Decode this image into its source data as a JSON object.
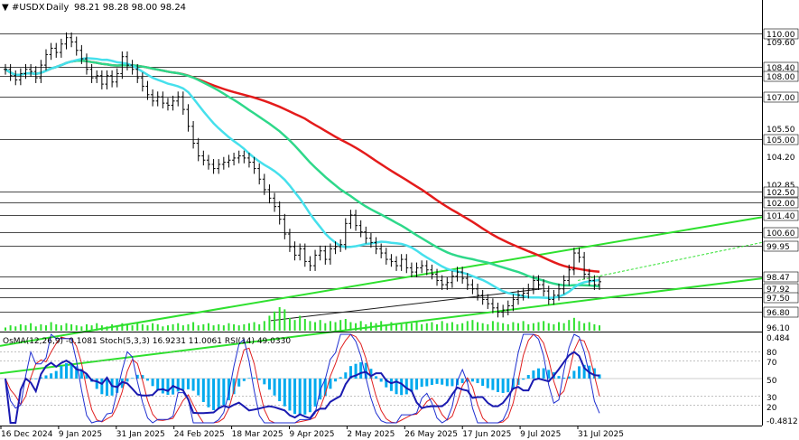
{
  "chart_data": [
    {
      "type": "candlestick",
      "symbol": "#USDX",
      "timeframe": "Daily",
      "ohlc_header": "98.21 98.28 98.00 98.24",
      "x_tick_labels": [
        "16 Dec 2024",
        "9 Jan 2025",
        "31 Jan 2025",
        "24 Feb 2025",
        "18 Mar 2025",
        "9 Apr 2025",
        "2 May 2025",
        "26 May 2025",
        "17 Jun 2025",
        "9 Jul 2025",
        "31 Jul 2025"
      ],
      "y_range": [
        96.35,
        110.9
      ],
      "level_tags": [
        {
          "label": "110.00",
          "value": 110.0,
          "color": "#ffffff"
        },
        {
          "label": "109.60",
          "value": 109.6,
          "color": "#000000"
        },
        {
          "label": "108.40",
          "value": 108.4,
          "color": "#ffffff"
        },
        {
          "label": "108.00",
          "value": 108.0,
          "color": "#ffffff"
        },
        {
          "label": "107.00",
          "value": 107.0,
          "color": "#ffffff"
        },
        {
          "label": "105.50",
          "value": 105.5,
          "color": "#000000"
        },
        {
          "label": "105.00",
          "value": 105.0,
          "color": "#ffffff"
        },
        {
          "label": "104.20",
          "value": 104.2,
          "color": "#000000"
        },
        {
          "label": "102.85",
          "value": 102.85,
          "color": "#000000"
        },
        {
          "label": "102.50",
          "value": 102.5,
          "color": "#ffffff"
        },
        {
          "label": "102.00",
          "value": 102.0,
          "color": "#ffffff"
        },
        {
          "label": "101.40",
          "value": 101.4,
          "color": "#ffffff"
        },
        {
          "label": "100.60",
          "value": 100.6,
          "color": "#ffffff"
        },
        {
          "label": "99.95",
          "value": 99.95,
          "color": "#ffffff"
        },
        {
          "label": "98.47",
          "value": 98.47,
          "color": "#ffffff"
        },
        {
          "label": "97.92",
          "value": 97.92,
          "color": "#ffffff"
        },
        {
          "label": "97.50",
          "value": 97.5,
          "color": "#ffffff"
        },
        {
          "label": "96.80",
          "value": 96.8,
          "color": "#ffffff"
        },
        {
          "label": "96.10",
          "value": 96.1,
          "color": "#000000"
        }
      ],
      "moving_average_colors": [
        "#e41b1b",
        "#2ed88a",
        "#46e0ec"
      ],
      "trend_line_color": "#2ee02e",
      "closes": [
        108.3,
        108.0,
        107.8,
        108.1,
        108.3,
        108.2,
        107.9,
        108.5,
        109.0,
        109.3,
        109.1,
        109.5,
        109.8,
        109.6,
        109.2,
        108.8,
        108.3,
        107.9,
        108.0,
        107.6,
        108.0,
        107.7,
        108.1,
        108.9,
        108.5,
        108.3,
        107.9,
        107.5,
        107.1,
        106.8,
        107.0,
        106.7,
        106.6,
        106.8,
        107.0,
        106.4,
        105.6,
        104.8,
        104.2,
        104.0,
        103.8,
        103.6,
        103.8,
        103.9,
        104.0,
        104.1,
        104.2,
        104.1,
        103.9,
        103.6,
        103.1,
        102.6,
        102.2,
        101.8,
        101.2,
        100.5,
        99.9,
        99.5,
        99.8,
        99.2,
        99.0,
        99.5,
        99.7,
        99.3,
        99.8,
        99.9,
        100.0,
        101.0,
        101.4,
        100.9,
        100.6,
        100.3,
        100.1,
        99.8,
        99.6,
        99.3,
        99.2,
        99.0,
        99.3,
        98.9,
        98.7,
        98.9,
        99.0,
        98.8,
        98.6,
        98.3,
        98.1,
        98.2,
        98.5,
        98.7,
        98.4,
        98.1,
        97.9,
        97.6,
        97.4,
        97.2,
        97.0,
        96.8,
        96.9,
        97.1,
        97.4,
        97.6,
        97.7,
        97.9,
        98.3,
        98.1,
        97.8,
        97.4,
        97.6,
        97.9,
        98.3,
        98.8,
        99.6,
        99.4,
        98.6,
        98.3,
        98.1,
        98.24
      ],
      "volumes": [
        3,
        5,
        4,
        6,
        5,
        7,
        4,
        6,
        5,
        8,
        6,
        5,
        7,
        6,
        5,
        4,
        6,
        5,
        7,
        5,
        4,
        6,
        5,
        7,
        6,
        5,
        8,
        6,
        5,
        7,
        6,
        4,
        5,
        6,
        7,
        5,
        6,
        8,
        5,
        6,
        7,
        5,
        6,
        5,
        7,
        6,
        5,
        6,
        7,
        8,
        6,
        9,
        14,
        18,
        22,
        20,
        12,
        10,
        14,
        11,
        9,
        8,
        10,
        7,
        9,
        8,
        10,
        11,
        8,
        7,
        9,
        6,
        8,
        7,
        9,
        6,
        8,
        7,
        6,
        8,
        7,
        9,
        6,
        7,
        8,
        6,
        9,
        7,
        8,
        6,
        7,
        9,
        10,
        8,
        7,
        6,
        9,
        8,
        7,
        6,
        8,
        7,
        9,
        6,
        7,
        8,
        9,
        7,
        6,
        8,
        7,
        10,
        12,
        9,
        7,
        8,
        6,
        5
      ]
    },
    {
      "type": "oscillator",
      "header": "OsMA(12,26,9) -0.1081  Stoch(5,3,3) 16.9231 11.0061  RSI(14) 49.0330",
      "scale_tags": [
        {
          "label": "0.484",
          "value": 0.484
        },
        {
          "label": "80",
          "value": 80
        },
        {
          "label": "70",
          "value": 70
        },
        {
          "label": "50",
          "value": 50
        },
        {
          "label": "30",
          "value": 30
        },
        {
          "label": "20",
          "value": 20
        },
        {
          "label": "-0.4812",
          "value": -0.4812
        }
      ],
      "series_colors": {
        "osma": "#00aaee",
        "stoch_main": "#1f2fd0",
        "stoch_signal": "#e02020",
        "rsi": "#1a1ab0"
      }
    }
  ]
}
